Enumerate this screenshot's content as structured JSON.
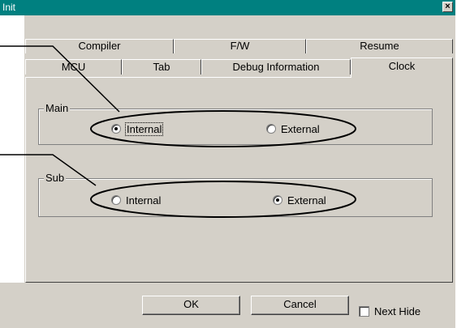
{
  "window": {
    "title": "Init",
    "close_glyph": "×"
  },
  "tabs_back": [
    {
      "label": "Compiler"
    },
    {
      "label": "F/W"
    },
    {
      "label": "Resume"
    }
  ],
  "tabs_front": [
    {
      "label": "MCU"
    },
    {
      "label": "Tab"
    },
    {
      "label": "Debug Information"
    },
    {
      "label": "Clock",
      "selected": true
    }
  ],
  "main_group": {
    "label": "Main",
    "internal_label": "Internal",
    "external_label": "External",
    "selected": "Internal"
  },
  "sub_group": {
    "label": "Sub",
    "internal_label": "Internal",
    "external_label": "External",
    "selected": "External"
  },
  "buttons": {
    "ok": "OK",
    "cancel": "Cancel"
  },
  "next_hide": {
    "label": "Next Hide",
    "checked": false
  }
}
